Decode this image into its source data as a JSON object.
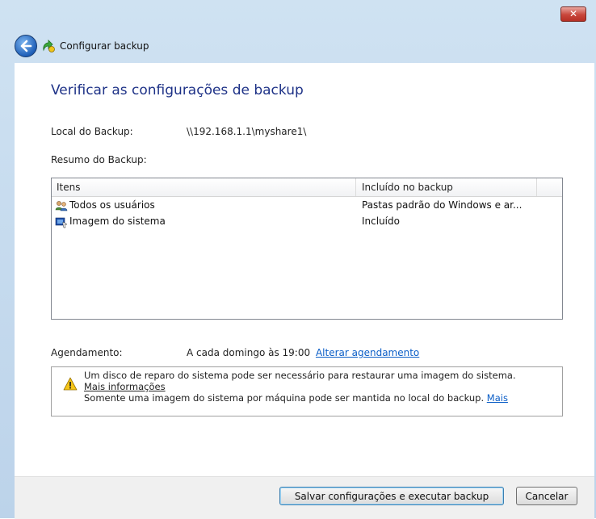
{
  "window": {
    "close_glyph": "✕",
    "title": "Configurar backup"
  },
  "page": {
    "heading": "Verificar as configurações de backup",
    "local_label": "Local do Backup:",
    "local_value": "\\\\192.168.1.1\\myshare1\\",
    "resumo_label": "Resumo do Backup:"
  },
  "table": {
    "columns": [
      "Itens",
      "Incluído no backup"
    ],
    "rows": [
      {
        "icon": "users-icon",
        "item": "Todos os usuários",
        "included": "Pastas padrão do Windows e ar..."
      },
      {
        "icon": "system-image-icon",
        "item": "Imagem do sistema",
        "included": "Incluído"
      }
    ]
  },
  "schedule": {
    "label": "Agendamento:",
    "value": "A cada domingo às 19:00",
    "link": "Alterar agendamento"
  },
  "warning": {
    "line1": "Um disco de reparo do sistema pode ser necessário para restaurar uma imagem do sistema.",
    "link1": "Mais informações",
    "line2": "Somente uma imagem do sistema por máquina pode ser mantida no local do backup.",
    "link2": "Mais"
  },
  "buttons": {
    "save": "Salvar configurações e executar backup",
    "cancel": "Cancelar"
  }
}
